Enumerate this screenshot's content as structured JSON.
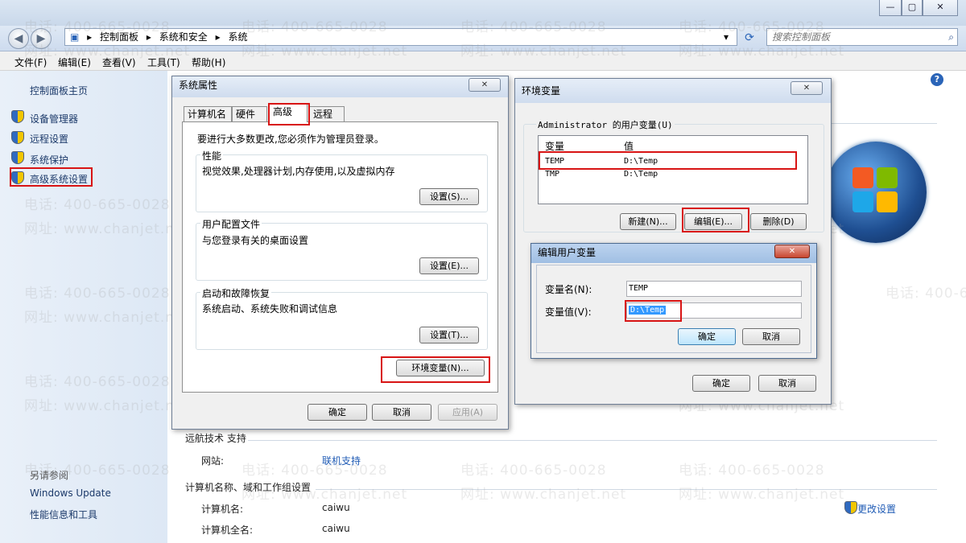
{
  "window": {
    "minimize": "—",
    "maximize": "▢",
    "close": "✕",
    "breadcrumb": [
      "控制面板",
      "系统和安全",
      "系统"
    ],
    "search_placeholder": "搜索控制面板"
  },
  "menu": [
    "文件(F)",
    "编辑(E)",
    "查看(V)",
    "工具(T)",
    "帮助(H)"
  ],
  "sidebar": {
    "home": "控制面板主页",
    "items": [
      "设备管理器",
      "远程设置",
      "系统保护",
      "高级系统设置"
    ],
    "see_also_title": "另请参阅",
    "see_also": [
      "Windows Update",
      "性能信息和工具"
    ]
  },
  "main": {
    "support_title": "远航技术 支持",
    "website_label": "网站:",
    "website_link": "联机支持",
    "computer_section_title": "计算机名称、域和工作组设置",
    "computer_name_label": "计算机名:",
    "computer_name_value": "caiwu",
    "full_name_label": "计算机全名:",
    "full_name_value": "caiwu",
    "change_settings": "更改设置"
  },
  "watermark": {
    "phone": "电话: 400-665-0028",
    "site": "网址: www.chanjet.net"
  },
  "sysprops": {
    "title": "系统属性",
    "close": "✕",
    "tabs": [
      "计算机名",
      "硬件",
      "高级",
      "远程"
    ],
    "admin_note": "要进行大多数更改,您必须作为管理员登录。",
    "groups": [
      {
        "title": "性能",
        "desc": "视觉效果,处理器计划,内存使用,以及虚拟内存",
        "button": "设置(S)..."
      },
      {
        "title": "用户配置文件",
        "desc": "与您登录有关的桌面设置",
        "button": "设置(E)..."
      },
      {
        "title": "启动和故障恢复",
        "desc": "系统启动、系统失败和调试信息",
        "button": "设置(T)..."
      }
    ],
    "env_button": "环境变量(N)...",
    "ok": "确定",
    "cancel": "取消",
    "apply": "应用(A)"
  },
  "envvars": {
    "title": "环境变量",
    "close": "✕",
    "user_vars_label": "Administrator 的用户变量(U)",
    "col_var": "变量",
    "col_val": "值",
    "rows": [
      {
        "name": "TEMP",
        "value": "D:\\Temp"
      },
      {
        "name": "TMP",
        "value": "D:\\Temp"
      }
    ],
    "new": "新建(N)...",
    "edit": "编辑(E)...",
    "delete": "删除(D)",
    "ok": "确定",
    "cancel": "取消"
  },
  "editvar": {
    "title": "编辑用户变量",
    "close": "✕",
    "name_label": "变量名(N):",
    "name_value": "TEMP",
    "value_label": "变量值(V):",
    "value_value": "D:\\Temp",
    "ok": "确定",
    "cancel": "取消"
  },
  "colors": {
    "highlight_red": "#d81414",
    "selection_blue": "#3399ff",
    "link_blue": "#1f5bb5"
  }
}
